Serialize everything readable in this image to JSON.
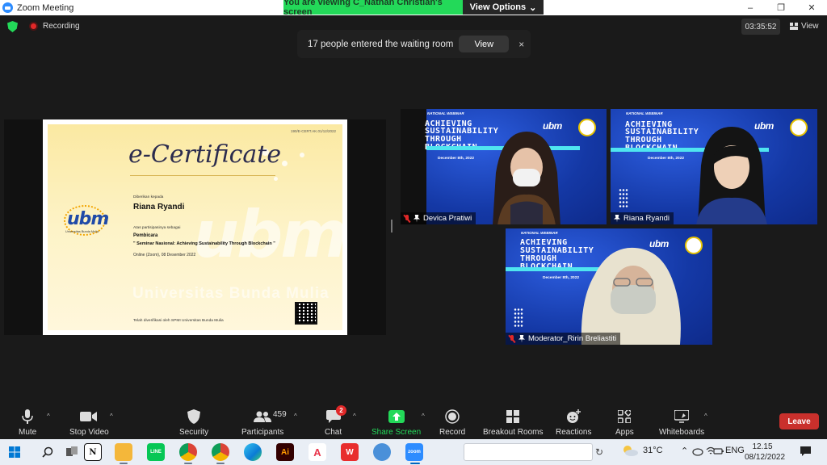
{
  "window": {
    "title": "Zoom Meeting",
    "minimize": "–",
    "maximize": "❐",
    "close": "✕"
  },
  "share_banner": {
    "viewing_text": "You are viewing C_Nathan Christian's screen",
    "view_options": "View Options",
    "caret": "⌄"
  },
  "topbar": {
    "recording": "Recording",
    "timer": "03:35:52",
    "view": "View"
  },
  "waiting_room": {
    "message": "17 people entered the waiting room",
    "view_button": "View",
    "close": "×"
  },
  "certificate": {
    "number": "190/E-CERT.AK.01/12/2022",
    "title": "e-Certificate",
    "given_to": "Diberikan kepada",
    "name": "Riana Ryandi",
    "participation": "Atas partisipasinya sebagai",
    "role": "Pembicara",
    "theme": "\" Seminar Nasional: Achieving Sustainability Through Blockchain \"",
    "place_date": "Online (Zoom), 08 Desember 2022",
    "verified": "Telah diverifikasi oleh SPMI Universitas Bunda Mulia",
    "logo": "ubm",
    "logo_sub": "Universitas Bunda Mulia",
    "watermark": "ubm",
    "watermark_sub": "Universitas Bunda Mulia"
  },
  "participants": [
    {
      "name": "Devica Pratiwi",
      "muted": true,
      "pinned": true
    },
    {
      "name": "Riana Ryandi",
      "muted": false,
      "pinned": true
    },
    {
      "name": "Moderator_Ririn Breliastiti",
      "muted": true,
      "pinned": true
    }
  ],
  "webinar_bg": {
    "tag": "NATIONAL WEBINAR",
    "line1": "ACHIEVING",
    "line2": "SUSTAINABILITY",
    "line3": "THROUGH",
    "line4": "BLOCKCHAIN",
    "date": "December 8th, 2022",
    "brand": "ubm"
  },
  "toolbar": {
    "mute": "Mute",
    "stop_video": "Stop Video",
    "security": "Security",
    "participants": "Participants",
    "participants_count": "459",
    "chat": "Chat",
    "chat_badge": "2",
    "share_screen": "Share Screen",
    "record": "Record",
    "breakout_rooms": "Breakout Rooms",
    "reactions": "Reactions",
    "apps": "Apps",
    "whiteboards": "Whiteboards",
    "leave": "Leave",
    "caret": "^"
  },
  "taskbar": {
    "temperature": "31°C",
    "language": "ENG",
    "time": "12.15",
    "date": "08/12/2022",
    "zoom_label": "zoom",
    "acrobat": "A",
    "illustrator": "Ai",
    "notion": "N",
    "line": "LINE",
    "wps": "W"
  },
  "colors": {
    "accent_green": "#23d959",
    "zoom_blue": "#2d8cff",
    "leave_red": "#c9302c",
    "webinar_blue": "#1c45c2"
  }
}
